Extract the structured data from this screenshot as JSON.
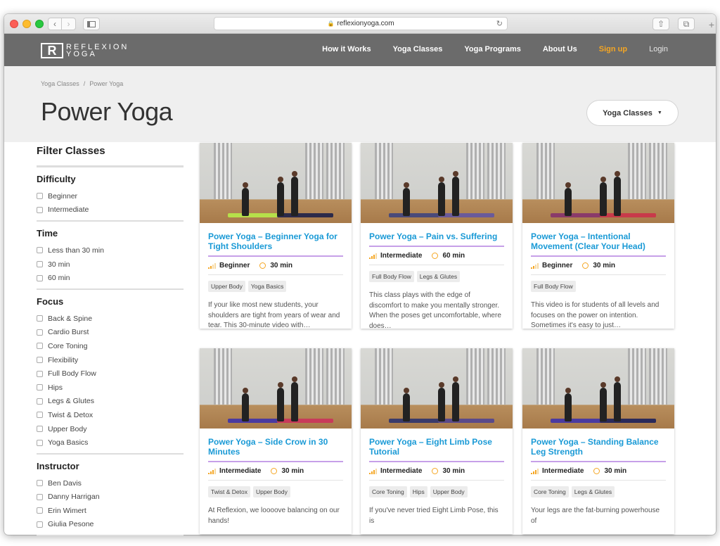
{
  "browser": {
    "url": "reflexionyoga.com"
  },
  "site": {
    "logo_mark": "R",
    "logo_line1": "REFLEXION",
    "logo_line2": "YOGA",
    "nav": [
      "How it Works",
      "Yoga Classes",
      "Yoga Programs",
      "About Us",
      "Sign up",
      "Login"
    ]
  },
  "hero": {
    "breadcrumb": [
      "Yoga Classes",
      "Power Yoga"
    ],
    "title": "Power Yoga",
    "category_select": "Yoga Classes"
  },
  "filters": {
    "heading": "Filter Classes",
    "groups": [
      {
        "name": "Difficulty",
        "options": [
          "Beginner",
          "Intermediate"
        ]
      },
      {
        "name": "Time",
        "options": [
          "Less than 30 min",
          "30 min",
          "60 min"
        ]
      },
      {
        "name": "Focus",
        "options": [
          "Back & Spine",
          "Cardio Burst",
          "Core Toning",
          "Flexibility",
          "Full Body Flow",
          "Hips",
          "Legs & Glutes",
          "Twist & Detox",
          "Upper Body",
          "Yoga Basics"
        ]
      },
      {
        "name": "Instructor",
        "options": [
          "Ben Davis",
          "Danny Harrigan",
          "Erin Wimert",
          "Giulia Pesone"
        ]
      }
    ]
  },
  "cards": [
    {
      "title": "Power Yoga – Beginner Yoga for Tight Shoulders",
      "level": "Beginner",
      "level_bars": 2,
      "time": "30 min",
      "tags": [
        "Upper Body",
        "Yoga Basics"
      ],
      "desc": "If your like most new students, your shoulders are tight from years of wear and tear. This 30-minute video with…"
    },
    {
      "title": "Power Yoga – Pain vs. Suffering",
      "level": "Intermediate",
      "level_bars": 3,
      "time": "60 min",
      "tags": [
        "Full Body Flow",
        "Legs & Glutes"
      ],
      "desc": "This class plays with the edge of discomfort to make you mentally stronger. When the poses get uncomfortable, where does…"
    },
    {
      "title": "Power Yoga – Intentional Movement (Clear Your Head)",
      "level": "Beginner",
      "level_bars": 2,
      "time": "30 min",
      "tags": [
        "Full Body Flow"
      ],
      "desc": "This video is for students of all levels and focuses on the power on intention. Sometimes it's easy to just…"
    },
    {
      "title": "Power Yoga – Side Crow in 30 Minutes",
      "level": "Intermediate",
      "level_bars": 3,
      "time": "30 min",
      "tags": [
        "Twist & Detox",
        "Upper Body"
      ],
      "desc": "At Reflexion, we loooove balancing on our hands!"
    },
    {
      "title": "Power Yoga – Eight Limb Pose Tutorial",
      "level": "Intermediate",
      "level_bars": 3,
      "time": "30 min",
      "tags": [
        "Core Toning",
        "Hips",
        "Upper Body"
      ],
      "desc": "If you've never tried Eight Limb Pose, this is"
    },
    {
      "title": "Power Yoga – Standing Balance Leg Strength",
      "level": "Intermediate",
      "level_bars": 3,
      "time": "30 min",
      "tags": [
        "Core Toning",
        "Legs & Glutes"
      ],
      "desc": "Your legs are the fat-burning powerhouse of"
    }
  ],
  "colors": {
    "accent_blue": "#1a9ad6",
    "accent_orange": "#f5a623",
    "divider_purple": "#c6a0e8",
    "nav_bg": "#6b6b6b"
  }
}
